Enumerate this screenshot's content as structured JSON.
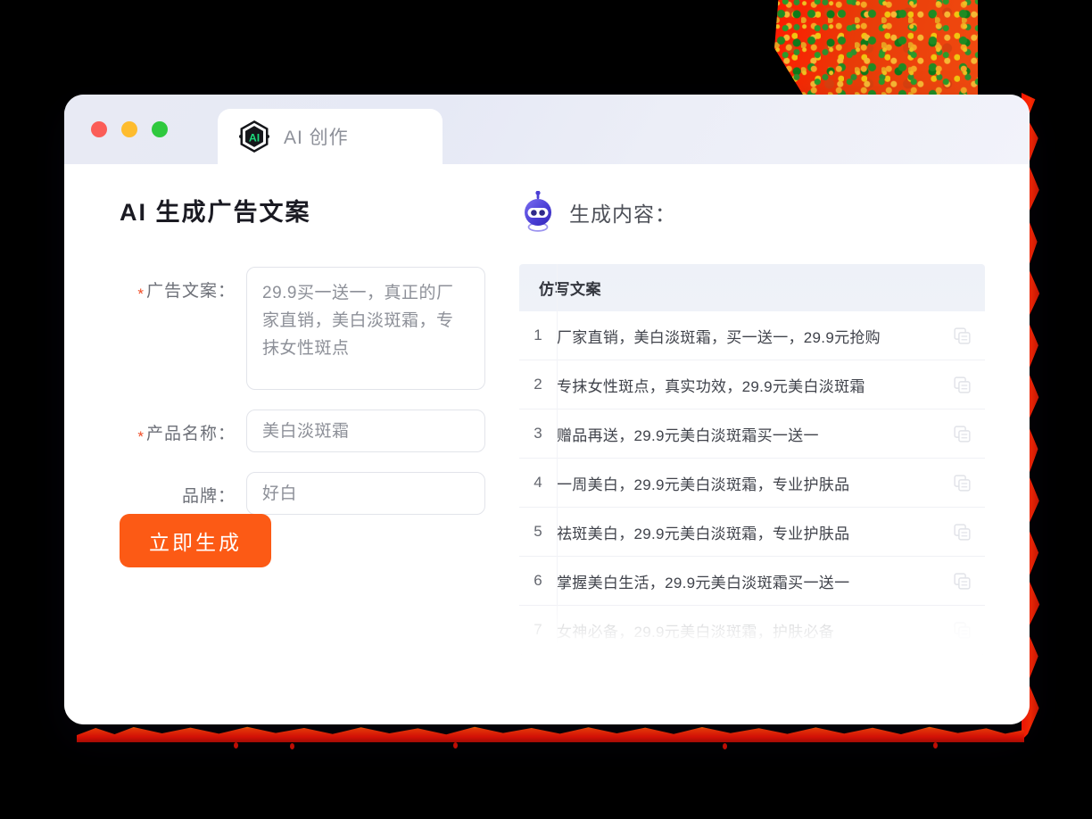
{
  "window": {
    "traffic_lights": [
      {
        "name": "close",
        "color": "#fb5d57"
      },
      {
        "name": "minimize",
        "color": "#febc2e"
      },
      {
        "name": "maximize",
        "color": "#2fc93e"
      }
    ],
    "tab": {
      "label": "AI 创作",
      "logo_text": "AI",
      "icon": "ai-hexagon-logo"
    }
  },
  "left": {
    "title": "AI 生成广告文案",
    "fields": [
      {
        "label": "广告文案：",
        "required": true,
        "type": "textarea",
        "value": "29.9买一送一，真正的厂家直销，美白淡斑霜，专抹女性斑点"
      },
      {
        "label": "产品名称：",
        "required": true,
        "type": "input",
        "value": "美白淡斑霜"
      },
      {
        "label": "品牌：",
        "required": false,
        "type": "input",
        "value": "好白"
      }
    ],
    "submit_label": "立即生成"
  },
  "right": {
    "heading": "生成内容：",
    "robot_icon": "robot-icon",
    "table": {
      "column_header": "仿写文案",
      "copy_icon": "copy-icon",
      "rows": [
        {
          "index": "1",
          "text": "厂家直销，美白淡斑霜，买一送一，29.9元抢购"
        },
        {
          "index": "2",
          "text": "专抹女性斑点，真实功效，29.9元美白淡斑霜"
        },
        {
          "index": "3",
          "text": "赠品再送，29.9元美白淡斑霜买一送一"
        },
        {
          "index": "4",
          "text": "一周美白，29.9元美白淡斑霜，专业护肤品"
        },
        {
          "index": "5",
          "text": "祛斑美白，29.9元美白淡斑霜，专业护肤品"
        },
        {
          "index": "6",
          "text": "掌握美白生活，29.9元美白淡斑霜买一送一"
        },
        {
          "index": "7",
          "text": "女神必备，29.9元美白淡斑霜，护肤必备"
        }
      ]
    }
  },
  "colors": {
    "accent_orange": "#fc5a15",
    "required_asterisk": "#f04b24",
    "logo_green": "#1ddb7c",
    "robot_blue": "#4b3fd6",
    "decor_red": "#ff1500"
  }
}
